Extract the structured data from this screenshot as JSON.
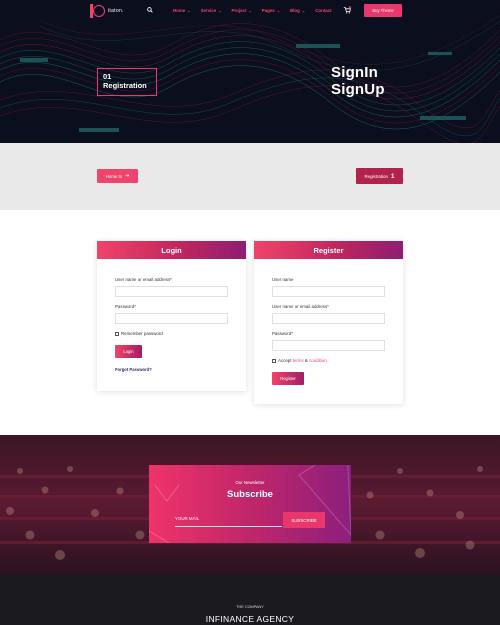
{
  "navbar": {
    "logo_text": "itaton.",
    "menu": [
      {
        "label": "Home",
        "has_dropdown": true
      },
      {
        "label": "Service",
        "has_dropdown": true
      },
      {
        "label": "Project",
        "has_dropdown": true
      },
      {
        "label": "Pages",
        "has_dropdown": true
      },
      {
        "label": "Blog",
        "has_dropdown": true
      },
      {
        "label": "Contact",
        "has_dropdown": false
      }
    ],
    "buy_label": "Buy Theme"
  },
  "hero": {
    "step_number": "01",
    "step_label": "Registration",
    "title_line1": "SignIn",
    "title_line2": "SignUp"
  },
  "breadcrumb": {
    "home_label": "Home to",
    "current_label": "Registration",
    "current_number": "1"
  },
  "login": {
    "title": "Login",
    "username_label": "User name or email address*",
    "password_label": "Password*",
    "remember_label": "Remember password",
    "button_label": "Login",
    "forgot_label": "Forgot Password?"
  },
  "register": {
    "title": "Register",
    "username_label": "User name",
    "email_label": "User name or email address*",
    "password_label": "Password*",
    "accept_prefix": "Accept",
    "terms_label": "terms",
    "and_label": "&",
    "condition_label": "condition",
    "button_label": "Register"
  },
  "newsletter": {
    "kicker": "Our Newsletter",
    "title": "Subscribe",
    "mail_placeholder": "YOUR MAIL",
    "button_label": "SUBSCRIBE"
  },
  "footer": {
    "kicker": "THE COMPANY",
    "title": "INFINANCE AGENCY"
  },
  "colors": {
    "accent": "#e8376c",
    "hero_bg": "#0b0e1d",
    "band_bg": "#e9e9e9",
    "footer_bg": "#1b1b1f"
  }
}
